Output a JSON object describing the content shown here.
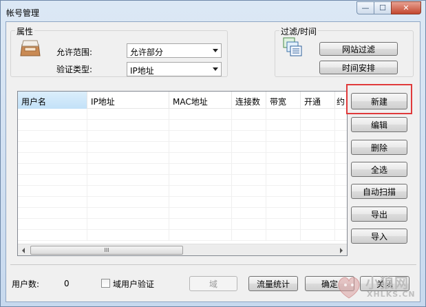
{
  "window": {
    "title": "帐号管理",
    "controls": {
      "minimize": "—",
      "maximize": "☐",
      "close": "✕"
    }
  },
  "properties": {
    "group_label": "属性",
    "icon": "tray-icon",
    "scope_label": "允许范围:",
    "scope_value": "允许部分",
    "auth_label": "验证类型:",
    "auth_value": "IP地址"
  },
  "filter": {
    "group_label": "过滤/时间",
    "icon": "filter-list-icon",
    "website_filter_label": "网站过滤",
    "schedule_label": "时间安排"
  },
  "table": {
    "columns": [
      "用户名",
      "IP地址",
      "MAC地址",
      "连接数",
      "带宽",
      "开通",
      "约"
    ],
    "rows": [],
    "scroll_thumb_grip": "III"
  },
  "actions": {
    "new": "新建",
    "edit": "编辑",
    "delete": "删除",
    "select_all": "全选",
    "auto_scan": "自动扫描",
    "export": "导出",
    "import": "导入"
  },
  "footer": {
    "user_count_label": "用户数:",
    "user_count_value": "0",
    "domain_auth_label": "域用户验证",
    "domain_button": "域",
    "traffic_stats": "流量统计",
    "ok": "确定",
    "close": "关闭"
  },
  "watermark": {
    "text": "小狼网",
    "sub": "XHLKS.CN"
  },
  "colors": {
    "highlight_box": "#e0393a",
    "selected_header": "#c3e1f8"
  }
}
